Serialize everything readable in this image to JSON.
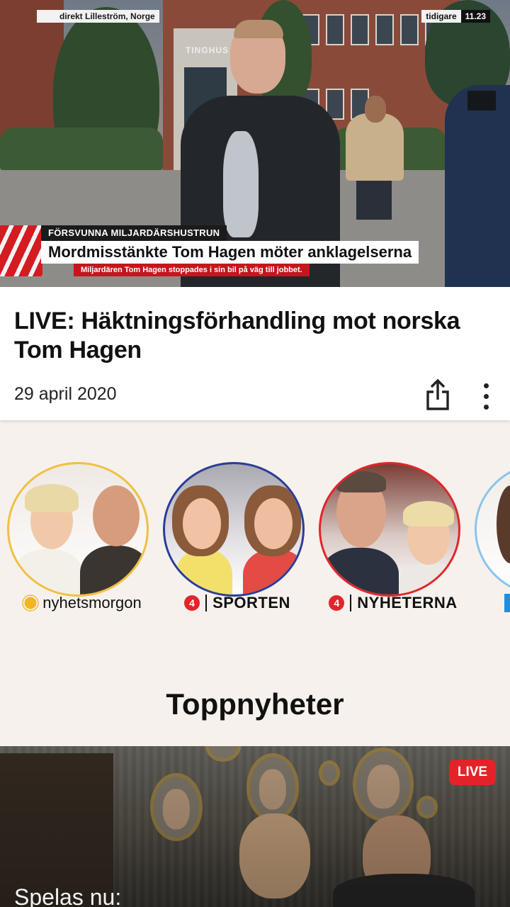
{
  "video": {
    "location": "direkt Lilleström, Norge",
    "earlier_label": "tidigare",
    "time": "11.23",
    "building_sign": "TINGHUS",
    "kicker": "FÖRSVUNNA MILJARDÄRSHUSTRUN",
    "headline": "Mordmisstänkte Tom Hagen möter anklagelserna",
    "subline": "Miljardären Tom Hagen stoppades i sin bil på väg till jobbet."
  },
  "article": {
    "title": "LIVE: Häktningsförhandling mot norska Tom Hagen",
    "date": "29 april 2020",
    "share_icon": "share-icon",
    "more_icon": "more-vertical-icon"
  },
  "programs": [
    {
      "name": "nyhetsmorgon",
      "ring_color": "#f0c040"
    },
    {
      "name": "SPORTEN",
      "channel": "4",
      "ring_color": "#2a3d99"
    },
    {
      "name": "NYHETERNA",
      "channel": "4",
      "ring_color": "#e0262b"
    }
  ],
  "section": {
    "title": "Toppnyheter"
  },
  "live_card": {
    "badge": "LIVE",
    "badge_color": "#e32329",
    "now_playing": "Spelas nu:"
  }
}
